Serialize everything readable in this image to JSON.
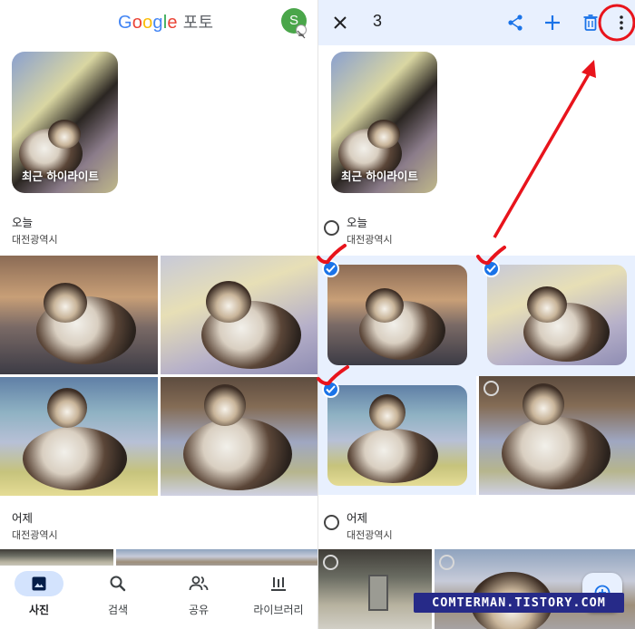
{
  "header": {
    "logo_letters": [
      "G",
      "o",
      "o",
      "g",
      "l",
      "e"
    ],
    "logo_suffix": "포토",
    "avatar_initial": "S"
  },
  "selection_bar": {
    "selected_count": "3",
    "icons": [
      "close-icon",
      "share-icon",
      "add-icon",
      "delete-icon",
      "more-vert-icon"
    ]
  },
  "highlight": {
    "caption": "최근 하이라이트"
  },
  "sections": [
    {
      "title": "오늘",
      "location": "대전광역시"
    },
    {
      "title": "어제",
      "location": "대전광역시"
    }
  ],
  "bottom_nav": {
    "items": [
      {
        "label": "사진",
        "icon": "photo-icon",
        "active": true
      },
      {
        "label": "검색",
        "icon": "search-icon",
        "active": false
      },
      {
        "label": "공유",
        "icon": "people-icon",
        "active": false
      },
      {
        "label": "라이브러리",
        "icon": "library-icon",
        "active": false
      }
    ]
  },
  "selection": {
    "selected_photos": 3,
    "total_today_photos": 4
  },
  "watermark": "COMTERMAN.TISTORY.COM",
  "colors": {
    "accent": "#1a73e8",
    "selection_bg": "#e8f0fe",
    "annotation": "#e8141c",
    "active_nav_pill": "#d3e3fd"
  }
}
